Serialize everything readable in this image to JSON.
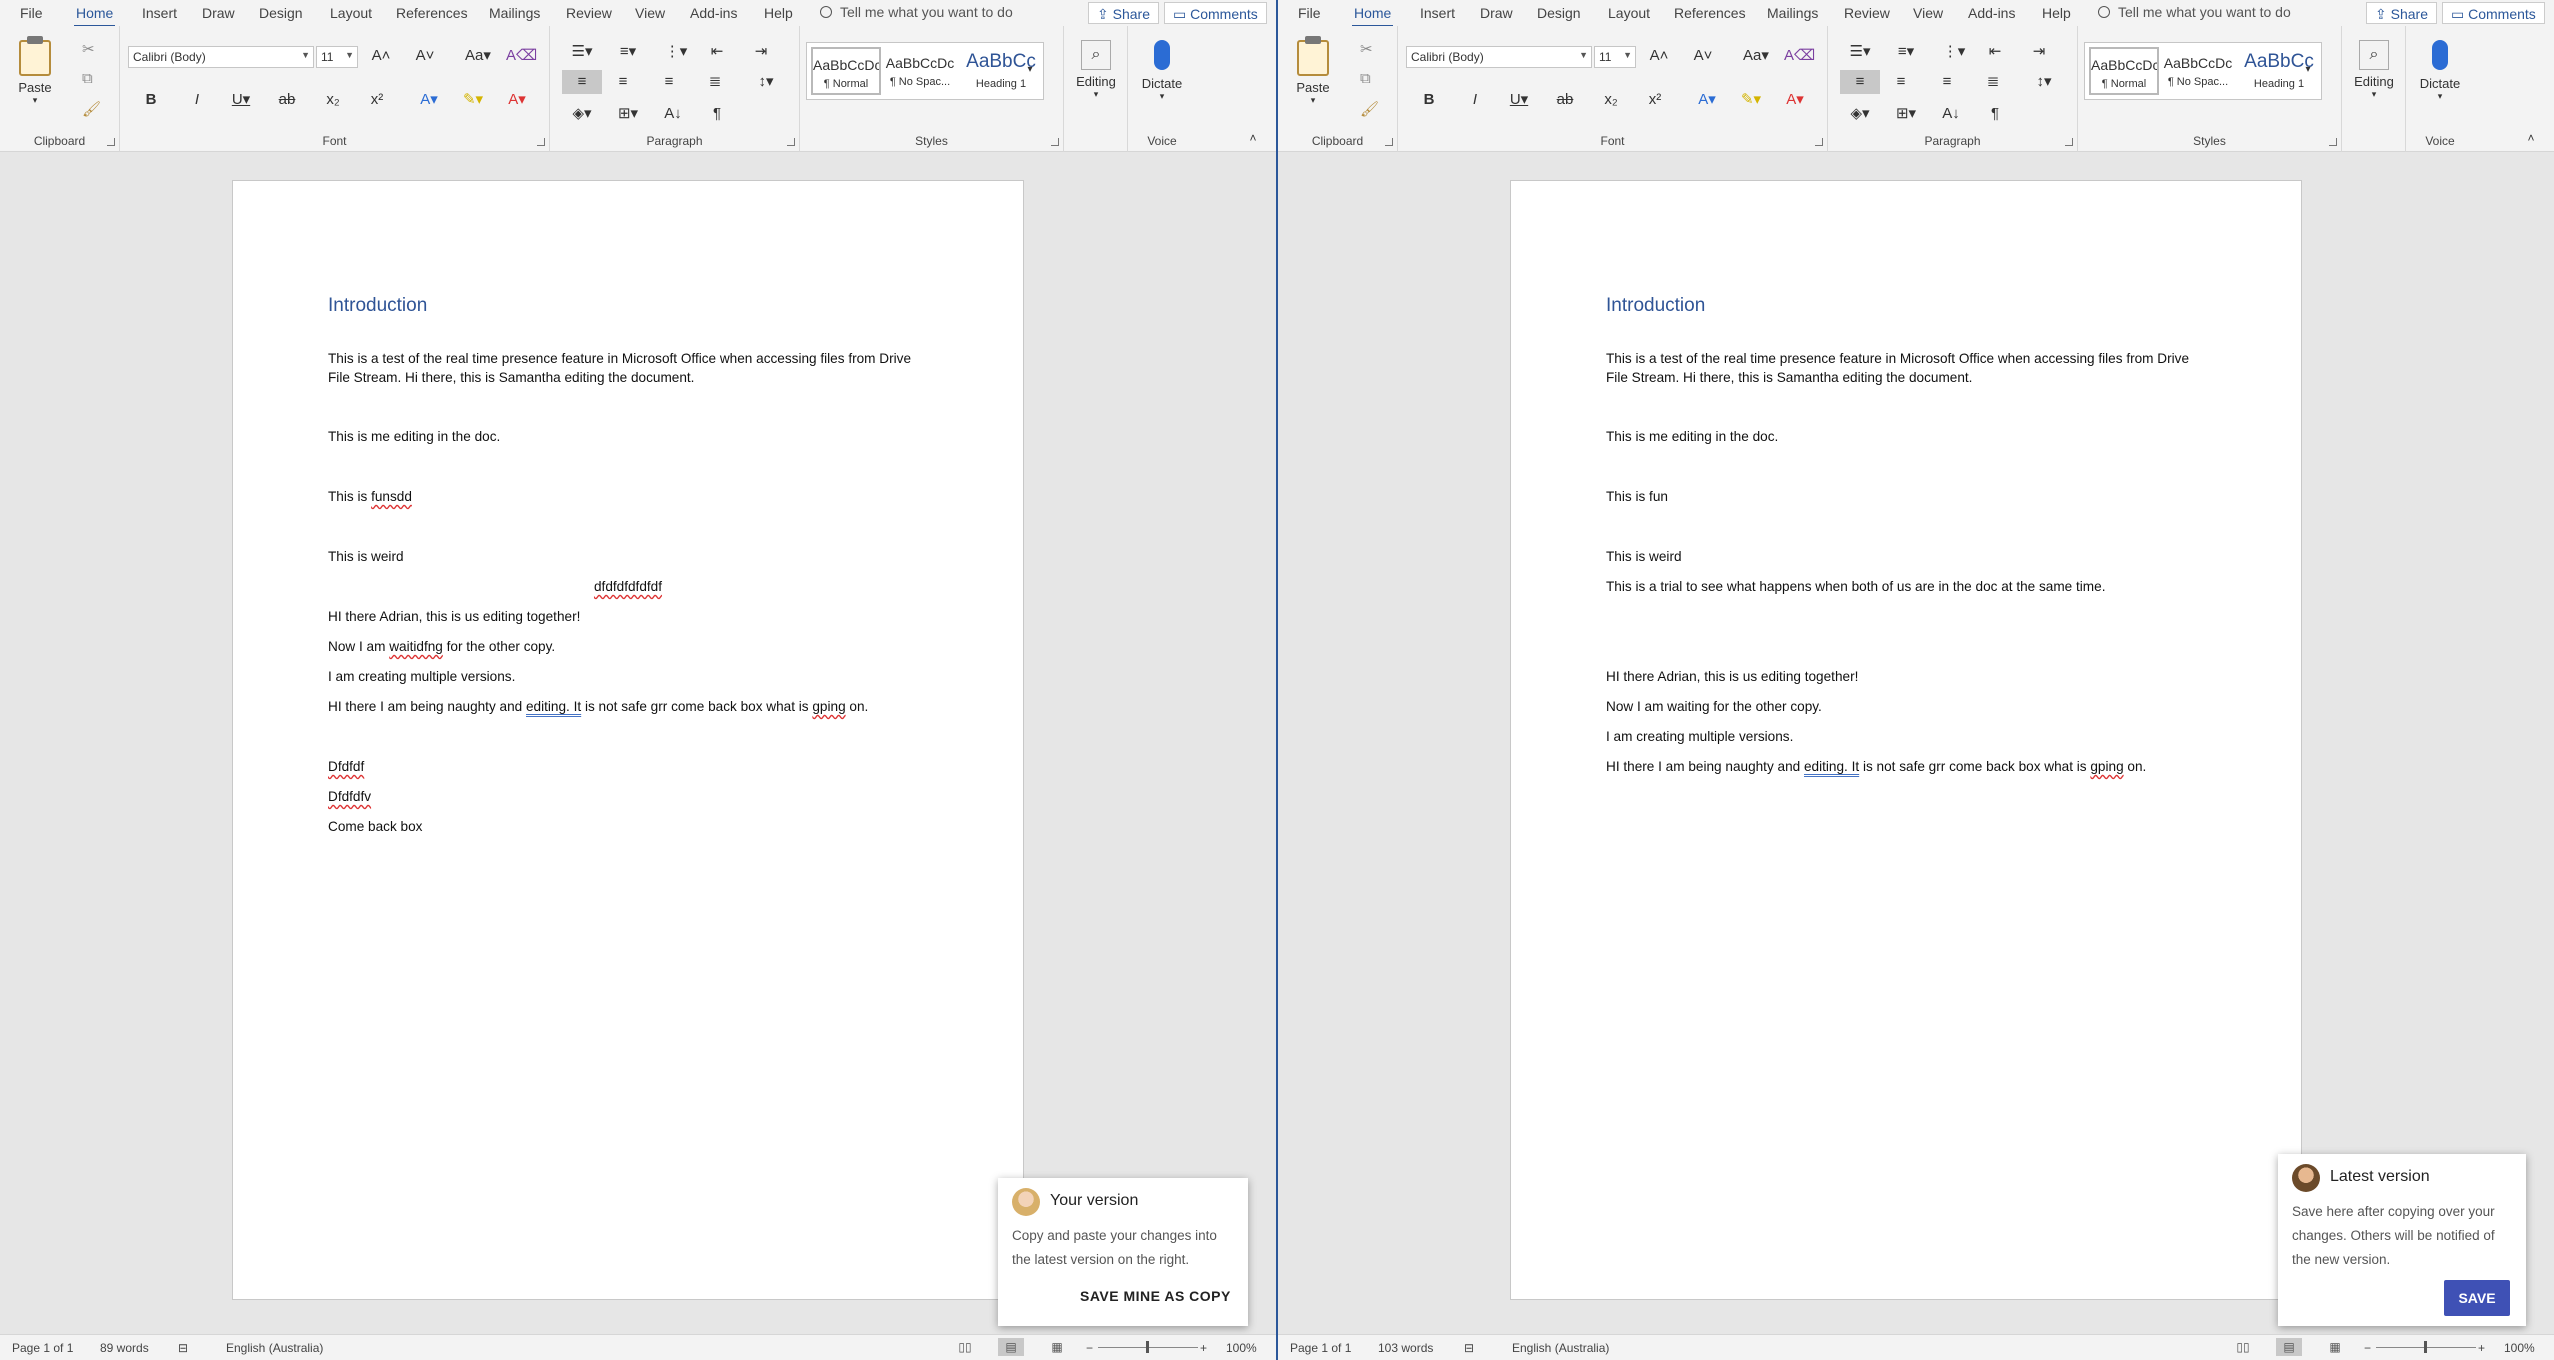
{
  "colors": {
    "accent": "#2b579a",
    "heading": "#2f5496",
    "save_button": "#3f51b5"
  },
  "ribbon_tabs": [
    "File",
    "Home",
    "Insert",
    "Draw",
    "Design",
    "Layout",
    "References",
    "Mailings",
    "Review",
    "View",
    "Add-ins",
    "Help"
  ],
  "active_tab": "Home",
  "tell_me": "Tell me what you want to do",
  "share": "Share",
  "comments": "Comments",
  "groups": {
    "clipboard": "Clipboard",
    "font": "Font",
    "paragraph": "Paragraph",
    "styles": "Styles",
    "voice": "Voice"
  },
  "paste": "Paste",
  "font_name": "Calibri (Body)",
  "font_size": "11",
  "style_gallery": [
    {
      "preview": "AaBbCcDc",
      "name": "¶ Normal"
    },
    {
      "preview": "AaBbCcDc",
      "name": "¶ No Spac..."
    },
    {
      "preview": "AaBbCc",
      "name": "Heading 1"
    }
  ],
  "editing": "Editing",
  "dictate": "Dictate",
  "left": {
    "heading": "Introduction",
    "p1": "This is a test of the real time presence feature in Microsoft Office when accessing files from Drive File Stream. Hi there, this is Samantha editing the document.",
    "p2": "This is me editing in the doc.",
    "p3_pre": "This is ",
    "p3_err": "funsdd",
    "p4": "This is weird",
    "p5": "dfdfdfdfdfdf",
    "p6": "HI there Adrian, this is us editing together!",
    "p7_pre": "Now I am ",
    "p7_err": "waitidfng",
    "p7_post": " for the other copy.",
    "p8": "I am creating multiple versions.",
    "p9_a": "HI there I am being naughty and ",
    "p9_b": "editing.  It",
    "p9_c": " is not safe  grr come back box what is ",
    "p9_d": "gping",
    "p9_e": " on.",
    "p10": "Dfdfdf",
    "p11": "Dfdfdfv",
    "p12": "Come back box",
    "status_page": "Page 1 of 1",
    "status_words": "89 words",
    "status_lang": "English (Australia)",
    "zoom": "100%",
    "popup_title": "Your version",
    "popup_body": "Copy and paste your changes into the latest version on the right.",
    "popup_button": "SAVE MINE AS COPY"
  },
  "right": {
    "heading": "Introduction",
    "p1": "This is a test of the real time presence feature in Microsoft Office when accessing files from Drive File Stream. Hi there, this is Samantha editing the document.",
    "p2": "This is me editing in the doc.",
    "p3": "This is fun",
    "p4": "This is weird",
    "p5": "This is a trial to see what happens when both of us are in the doc at the same time.",
    "p6": "HI there Adrian, this is us editing together!",
    "p7": "Now I am waiting for the other copy.",
    "p8": "I am creating multiple versions.",
    "p9_a": "HI there I am being naughty and ",
    "p9_b": "editing.  It",
    "p9_c": " is not safe  grr come back box what is ",
    "p9_d": "gping",
    "p9_e": " on.",
    "status_page": "Page 1 of 1",
    "status_words": "103 words",
    "status_lang": "English (Australia)",
    "zoom": "100%",
    "popup_title": "Latest version",
    "popup_body": "Save here after copying over your changes. Others will be notified of the new version.",
    "popup_button": "SAVE"
  }
}
